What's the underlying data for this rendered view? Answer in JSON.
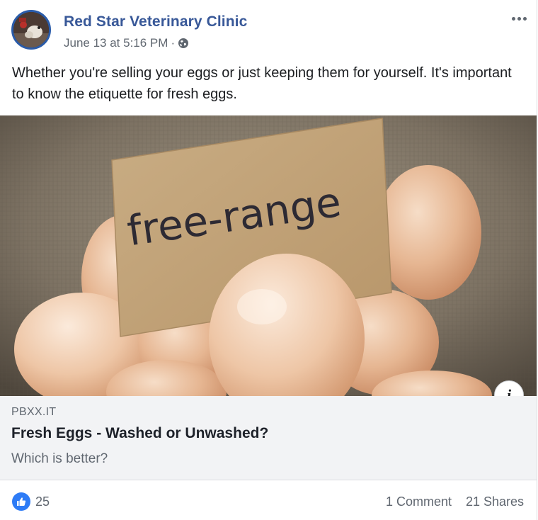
{
  "post": {
    "page_name": "Red Star Veterinary Clinic",
    "timestamp": "June 13 at 5:16 PM",
    "separator": "·",
    "audience_icon": "globe-icon",
    "more_icon": "more-options-icon",
    "text": "Whether you're selling your eggs or just keeping them for yourself. It's important to know the etiquette for fresh eggs."
  },
  "link_preview": {
    "image_sign_text": "free-range",
    "info_icon_label": "i",
    "domain": "PBXX.IT",
    "title": "Fresh Eggs - Washed or Unwashed?",
    "description": "Which is better?"
  },
  "engagement": {
    "reaction_icon": "like-icon",
    "reaction_count": "25",
    "comments": "1 Comment",
    "shares": "21 Shares"
  },
  "colors": {
    "page_name": "#385898",
    "meta_text": "#606770",
    "link_bg": "#f2f3f5",
    "like_blue": "#2e7cf6"
  }
}
